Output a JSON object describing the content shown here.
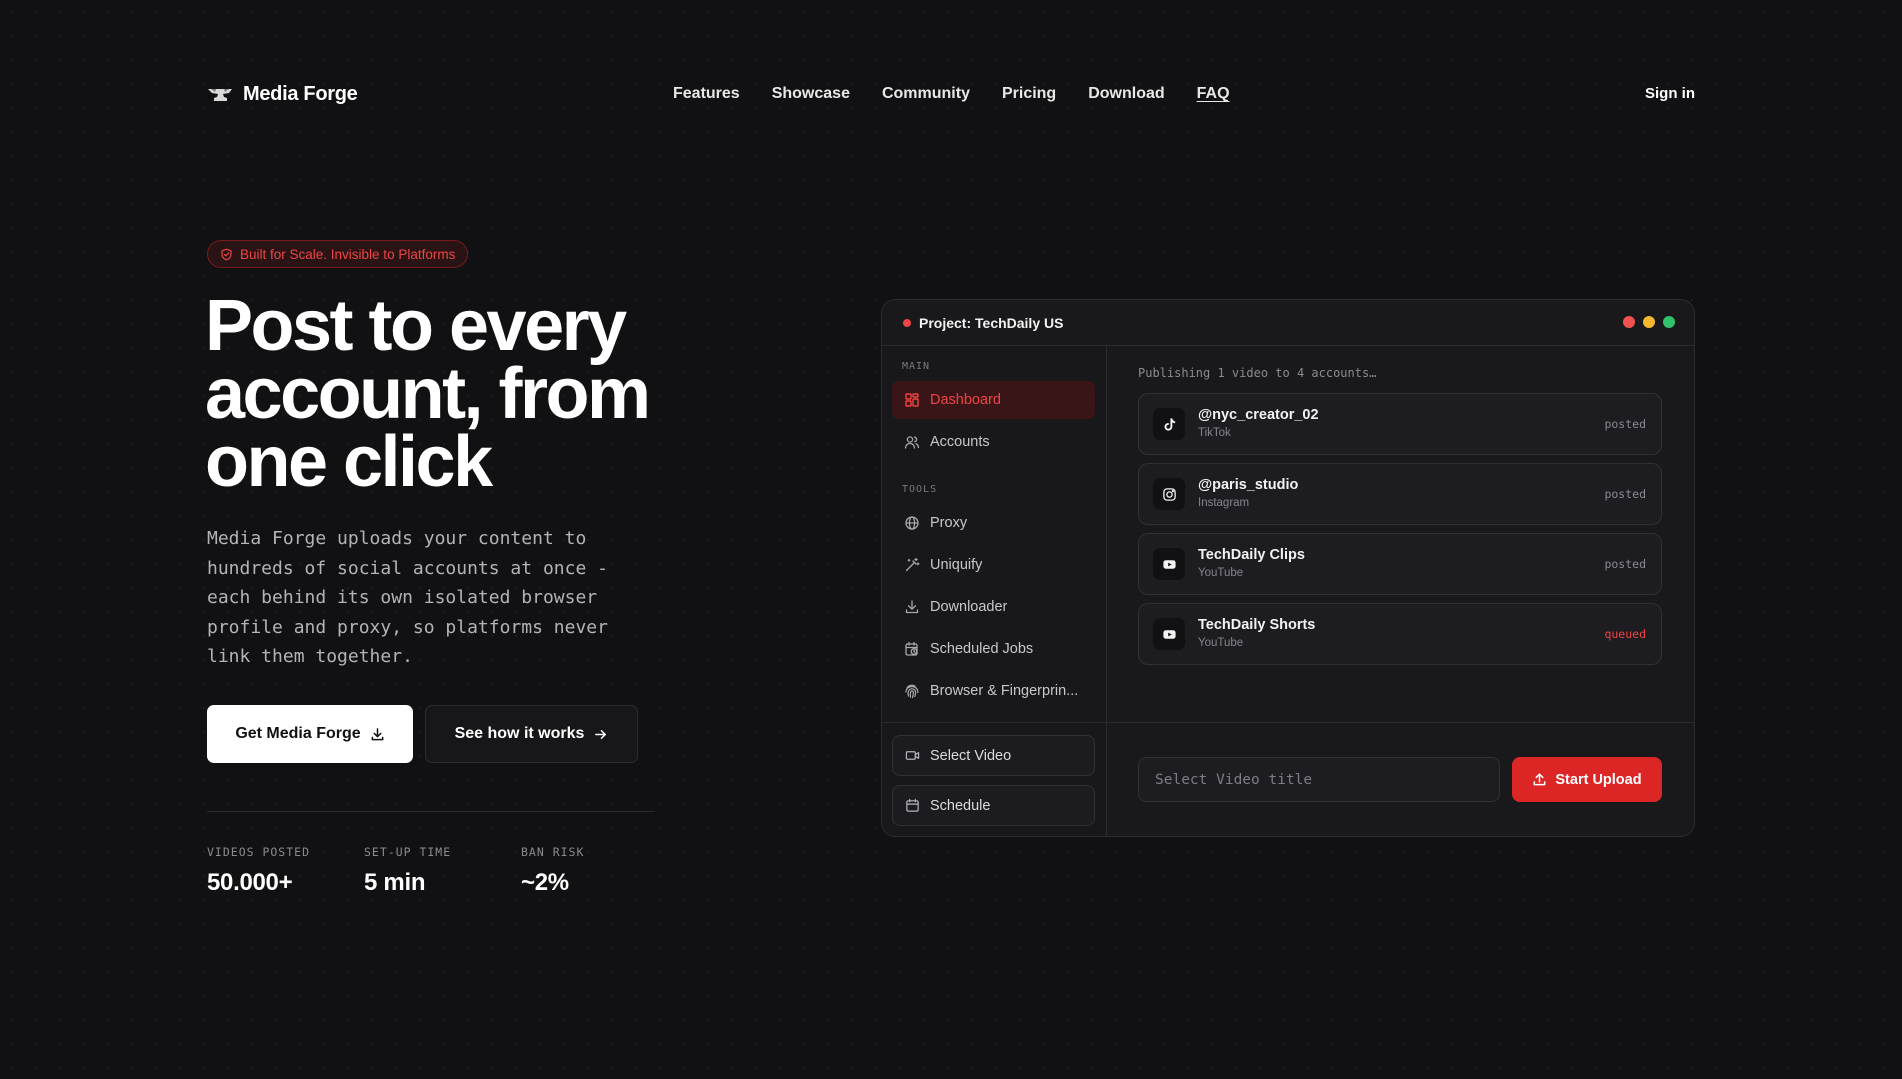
{
  "brand": {
    "name": "Media Forge",
    "logo_icon": "anvil-icon"
  },
  "nav": {
    "links": [
      "Features",
      "Showcase",
      "Community",
      "Pricing",
      "Download",
      "FAQ"
    ],
    "sign_in": "Sign in"
  },
  "hero": {
    "badge": "Built for Scale. Invisible to Platforms",
    "badge_icon": "shield-check-icon",
    "title_lines": [
      "Post to every",
      "account, from",
      "one click"
    ],
    "description": "Media Forge uploads your content to hundreds of social accounts at once - each behind its own isolated browser profile and proxy, so platforms never link them together.",
    "cta_primary": "Get Media Forge",
    "cta_primary_icon": "download-icon",
    "cta_secondary": "See how it works",
    "cta_secondary_icon": "arrow-right-icon"
  },
  "stats": [
    {
      "label": "VIDEOS POSTED",
      "value": "50.000+"
    },
    {
      "label": "SET-UP TIME",
      "value": "5 min"
    },
    {
      "label": "BAN RISK",
      "value": "~2%"
    }
  ],
  "app": {
    "title": "Project: TechDaily US",
    "sidebar": {
      "main_label": "MAIN",
      "tools_label": "TOOLS",
      "main_items": [
        {
          "label": "Dashboard",
          "icon": "grid-icon",
          "active": true
        },
        {
          "label": "Accounts",
          "icon": "users-icon",
          "active": false
        }
      ],
      "tool_items": [
        {
          "label": "Proxy",
          "icon": "globe-icon"
        },
        {
          "label": "Uniquify",
          "icon": "magic-wand-icon"
        },
        {
          "label": "Downloader",
          "icon": "download-icon"
        },
        {
          "label": "Scheduled Jobs",
          "icon": "calendar-clock-icon"
        },
        {
          "label": "Browser & Fingerprin...",
          "icon": "fingerprint-icon"
        }
      ],
      "select_video": "Select Video",
      "schedule": "Schedule"
    },
    "publishing_status": "Publishing 1 video to 4 accounts…",
    "accounts": [
      {
        "name": "@nyc_creator_02",
        "platform": "TikTok",
        "status": "posted",
        "icon": "tiktok-icon"
      },
      {
        "name": "@paris_studio",
        "platform": "Instagram",
        "status": "posted",
        "icon": "instagram-icon"
      },
      {
        "name": "TechDaily Clips",
        "platform": "YouTube",
        "status": "posted",
        "icon": "youtube-icon"
      },
      {
        "name": "TechDaily Shorts",
        "platform": "YouTube",
        "status": "queued",
        "icon": "youtube-icon"
      }
    ],
    "title_placeholder": "Select Video title",
    "start_upload": "Start Upload"
  },
  "colors": {
    "background": "#111113",
    "accent": "#dc2626",
    "accent_text": "#ef4444"
  }
}
